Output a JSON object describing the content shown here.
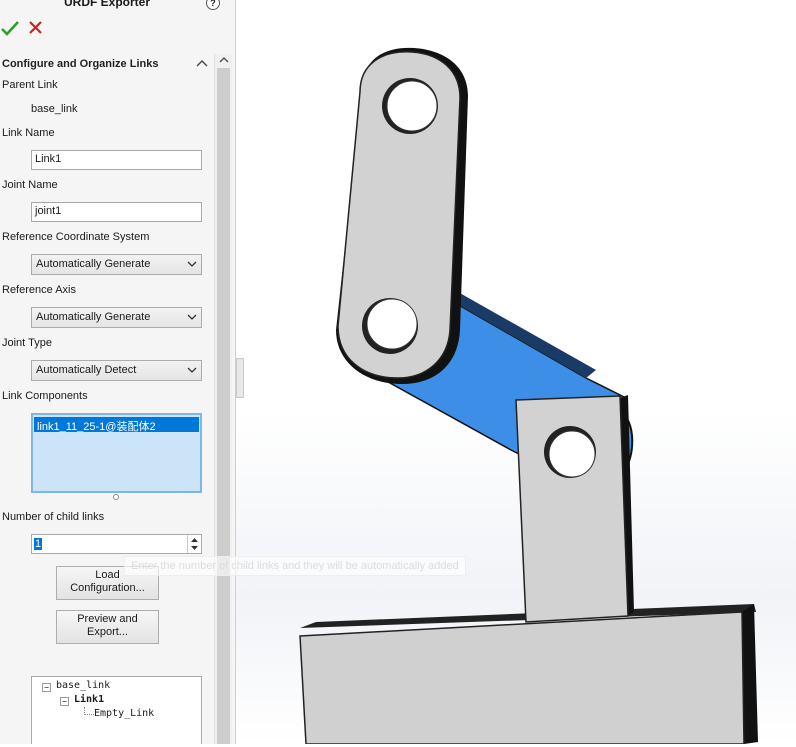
{
  "panel": {
    "title": "URDF Exporter",
    "help_icon": "help-icon",
    "ok_icon": "checkmark-icon",
    "cancel_icon": "x-icon",
    "section_title": "Configure and Organize Links",
    "parent_link_label": "Parent Link",
    "parent_link_value": "base_link",
    "link_name_label": "Link Name",
    "link_name_value": "Link1",
    "joint_name_label": "Joint Name",
    "joint_name_value": "joint1",
    "ref_coord_label": "Reference Coordinate System",
    "ref_coord_value": "Automatically Generate",
    "ref_axis_label": "Reference Axis",
    "ref_axis_value": "Automatically Generate",
    "joint_type_label": "Joint Type",
    "joint_type_value": "Automatically Detect",
    "link_components_label": "Link Components",
    "link_components": [
      "link1_11_25-1@装配体2"
    ],
    "child_links_label": "Number of child links",
    "child_links_value": "1",
    "tooltip": "Enter the number of child links and they will be automatically added",
    "load_button": [
      "Load",
      "Configuration..."
    ],
    "preview_button": [
      "Preview and",
      "Export..."
    ],
    "tree": {
      "root": "base_link",
      "child": "Link1",
      "grandchild": "Empty_Link"
    }
  },
  "colors": {
    "accent": "#0078d7",
    "selected_link": "#3b8de8",
    "part_gray": "#d2d2d2",
    "ok_green": "#2e9e2e",
    "cancel_red": "#cc2222"
  }
}
